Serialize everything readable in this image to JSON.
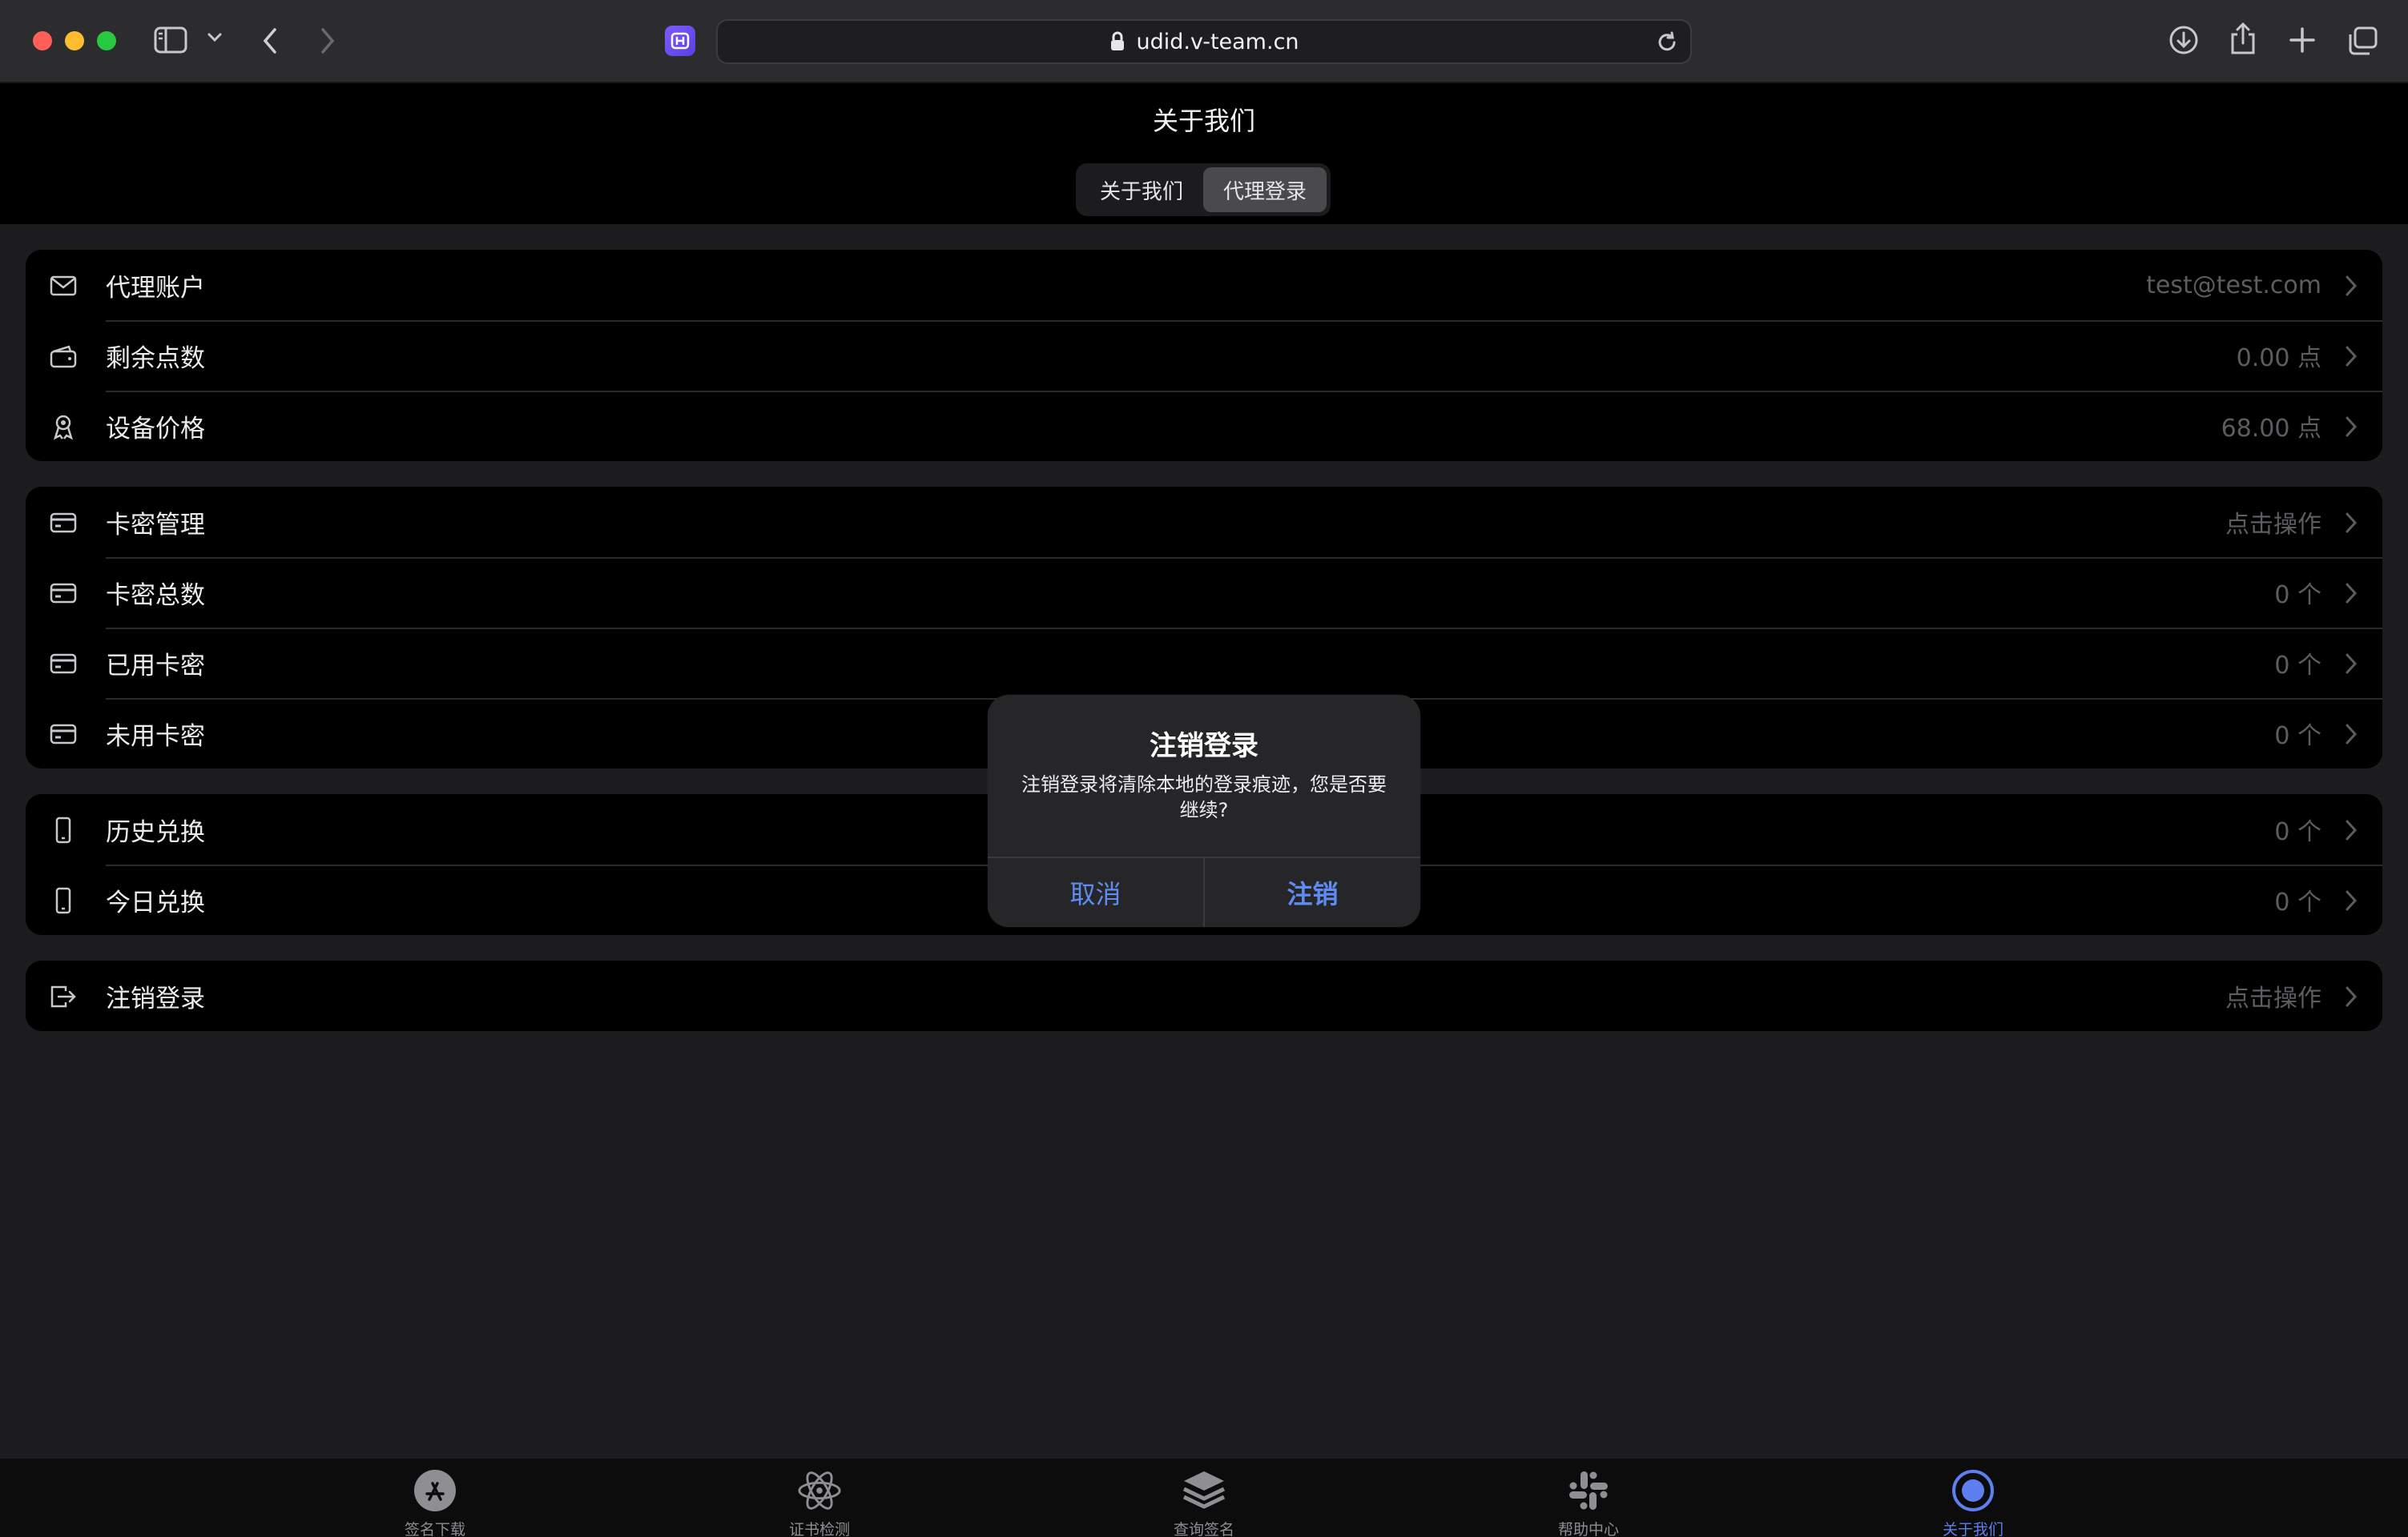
{
  "browser": {
    "url": "udid.v-team.cn"
  },
  "header": {
    "title": "关于我们",
    "segments": [
      {
        "label": "关于我们",
        "active": false
      },
      {
        "label": "代理登录",
        "active": true
      }
    ]
  },
  "groups": [
    [
      {
        "icon": "mail-icon",
        "label": "代理账户",
        "value": "test@test.com"
      },
      {
        "icon": "wallet-icon",
        "label": "剩余点数",
        "value": "0.00 点"
      },
      {
        "icon": "award-icon",
        "label": "设备价格",
        "value": "68.00 点"
      }
    ],
    [
      {
        "icon": "card-icon",
        "label": "卡密管理",
        "value": "点击操作"
      },
      {
        "icon": "card-icon",
        "label": "卡密总数",
        "value": "0 个"
      },
      {
        "icon": "card-icon",
        "label": "已用卡密",
        "value": "0 个"
      },
      {
        "icon": "card-icon",
        "label": "未用卡密",
        "value": "0 个"
      }
    ],
    [
      {
        "icon": "phone-icon",
        "label": "历史兑换",
        "value": "0 个"
      },
      {
        "icon": "phone-icon",
        "label": "今日兑换",
        "value": "0 个"
      }
    ],
    [
      {
        "icon": "logout-icon",
        "label": "注销登录",
        "value": "点击操作"
      }
    ]
  ],
  "dialog": {
    "title": "注销登录",
    "message": "注销登录将清除本地的登录痕迹，您是否要继续?",
    "cancel": "取消",
    "confirm": "注销"
  },
  "tabbar": [
    {
      "icon": "app-store-icon",
      "label": "签名下载",
      "active": false
    },
    {
      "icon": "atom-icon",
      "label": "证书检测",
      "active": false
    },
    {
      "icon": "layers-icon",
      "label": "查询签名",
      "active": false
    },
    {
      "icon": "slack-icon",
      "label": "帮助中心",
      "active": false
    },
    {
      "icon": "target-icon",
      "label": "关于我们",
      "active": true
    }
  ],
  "colors": {
    "accent": "#5e8cf2",
    "tab_active": "#5e7ff0",
    "background": "#1c1c1e",
    "card": "#000000"
  }
}
